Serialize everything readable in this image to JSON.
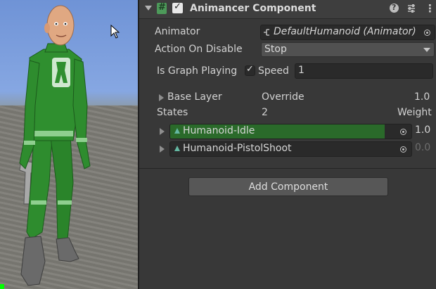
{
  "component": {
    "title": "Animancer Component",
    "enabled_check": "✓",
    "help_glyph": "?",
    "menu_glyph": "⋮"
  },
  "animator": {
    "label": "Animator",
    "value": "DefaultHumanoid (Animator)"
  },
  "action_on_disable": {
    "label": "Action On Disable",
    "value": "Stop"
  },
  "graph": {
    "playing_label": "Is Graph Playing",
    "playing_check": "✓",
    "speed_label": "Speed",
    "speed_value": "1"
  },
  "base_layer": {
    "label": "Base Layer",
    "mode": "Override",
    "weight": "1.0"
  },
  "states_header": {
    "label": "States",
    "count": "2",
    "weight_label": "Weight"
  },
  "states": [
    {
      "name": "Humanoid-Idle",
      "weight": "1.0",
      "weight_fraction": 1.0,
      "active": true
    },
    {
      "name": "Humanoid-PistolShoot",
      "weight": "0.0",
      "weight_fraction": 0.0,
      "active": false
    }
  ],
  "add_component_label": "Add Component",
  "colors": {
    "inspector_bg": "#383838",
    "header_bg": "#3e3e3e",
    "active_state": "#2a6a2a",
    "sky": "#7a9ee0",
    "suit_green": "#2d8a2d"
  },
  "icons": {
    "script": "script-hash-icon",
    "animator": "animator-tree-icon",
    "foldout": "foldout-arrow-icon",
    "target": "object-picker-icon",
    "state": "animation-state-icon",
    "presets": "presets-icon",
    "cursor": "mouse-pointer-icon"
  }
}
